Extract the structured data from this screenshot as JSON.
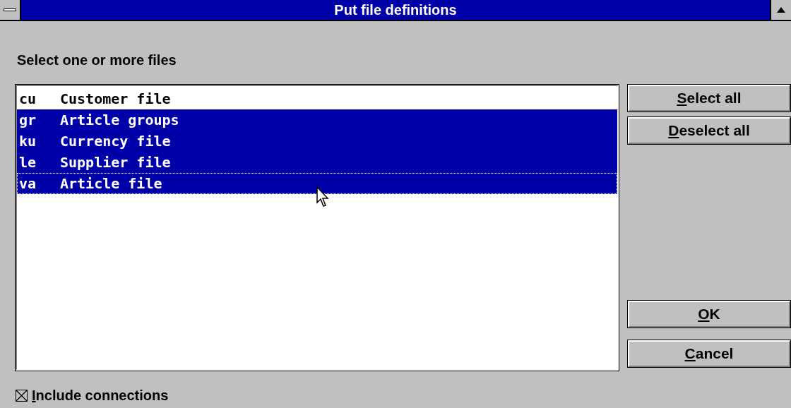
{
  "window": {
    "title": "Put file definitions"
  },
  "prompt": "Select one or more files",
  "files": [
    {
      "code": "cu",
      "name": "Customer file",
      "selected": false,
      "focused": false
    },
    {
      "code": "gr",
      "name": "Article groups",
      "selected": true,
      "focused": false
    },
    {
      "code": "ku",
      "name": "Currency file",
      "selected": true,
      "focused": false
    },
    {
      "code": "le",
      "name": "Supplier file",
      "selected": true,
      "focused": false
    },
    {
      "code": "va",
      "name": "Article file",
      "selected": true,
      "focused": true
    }
  ],
  "top_buttons": [
    "Select all",
    "Deselect all"
  ],
  "bottom_buttons": [
    "OK",
    "Cancel"
  ],
  "include_connections": {
    "label": "Include connections",
    "checked": true
  }
}
